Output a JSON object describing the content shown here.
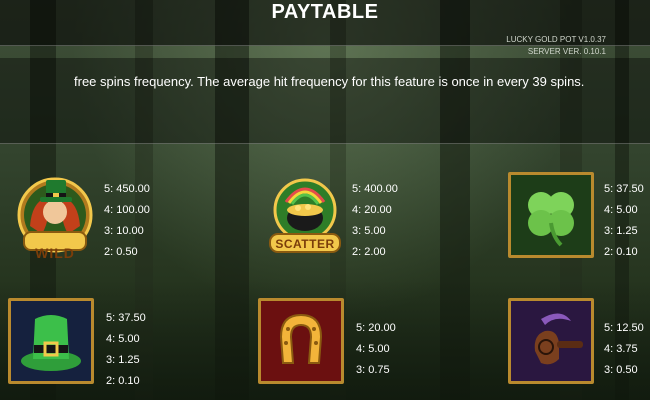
{
  "header": {
    "title": "PAYTABLE",
    "version_line1": "LUCKY GOLD POT V1.0.37",
    "version_line2": "SERVER VER. 0.10.1"
  },
  "info": {
    "text": "free spins frequency. The average hit frequency for this feature is once in every 39 spins."
  },
  "symbols": [
    {
      "id": "wild",
      "label": "WILD",
      "payouts": [
        "5: 450.00",
        "4: 100.00",
        "3: 10.00",
        "2: 0.50"
      ]
    },
    {
      "id": "scatter",
      "label": "SCATTER",
      "payouts": [
        "5: 400.00",
        "4: 20.00",
        "3: 5.00",
        "2: 2.00"
      ]
    },
    {
      "id": "clover",
      "payouts": [
        "5: 37.50",
        "4: 5.00",
        "3: 1.25",
        "2: 0.10"
      ]
    },
    {
      "id": "hat",
      "payouts": [
        "5: 37.50",
        "4: 5.00",
        "3: 1.25",
        "2: 0.10"
      ]
    },
    {
      "id": "horseshoe",
      "payouts": [
        "5: 20.00",
        "4: 5.00",
        "3: 0.75"
      ]
    },
    {
      "id": "pipe",
      "payouts": [
        "5: 12.50",
        "4: 3.75",
        "3: 0.50"
      ]
    }
  ]
}
